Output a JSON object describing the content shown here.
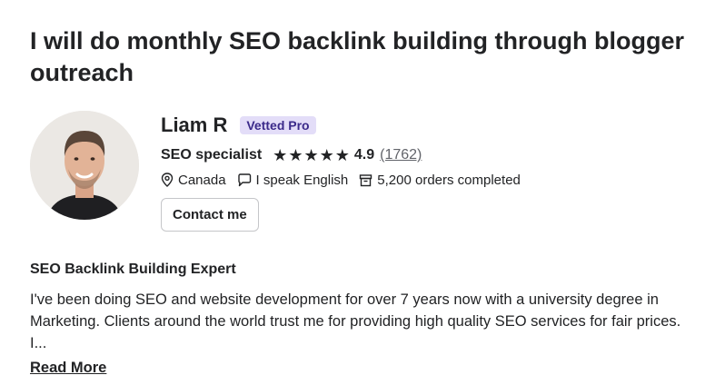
{
  "gig": {
    "title": "I will do monthly SEO backlink building through blogger outreach"
  },
  "seller": {
    "name": "Liam R",
    "badge": "Vetted Pro",
    "role": "SEO specialist",
    "stars": [
      "★",
      "★",
      "★",
      "★",
      "★"
    ],
    "rating": "4.9",
    "reviews": "(1762)",
    "location": "Canada",
    "language": "I speak English",
    "orders": "5,200 orders completed",
    "contact_label": "Contact me"
  },
  "about": {
    "heading": "SEO Backlink Building Expert",
    "text": "I've been doing SEO and website development for over 7 years now with a university degree in Marketing. Clients around the world trust me for providing high quality SEO services for fair prices. I...",
    "read_more": "Read More"
  },
  "icons": {
    "location": "location-pin-icon",
    "language": "chat-bubble-icon",
    "orders": "box-icon",
    "star": "star-icon"
  }
}
